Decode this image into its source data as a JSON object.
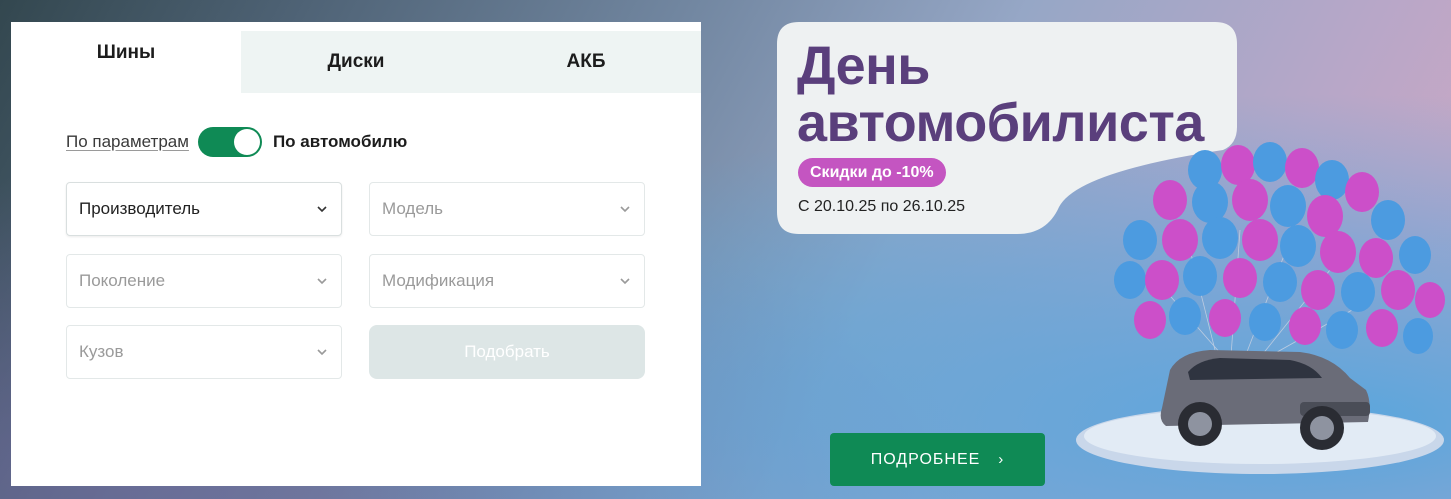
{
  "tabs": [
    {
      "label": "Шины",
      "active": true
    },
    {
      "label": "Диски",
      "active": false
    },
    {
      "label": "АКБ",
      "active": false
    }
  ],
  "mode_toggle": {
    "left_label": "По параметрам",
    "right_label": "По автомобилю",
    "state": "По автомобилю"
  },
  "selects": {
    "manufacturer": "Производитель",
    "model": "Модель",
    "generation": "Поколение",
    "modification": "Модификация",
    "body": "Кузов"
  },
  "pick_button": "Подобрать",
  "promo": {
    "title_line1": "День",
    "title_line2": "автомобилиста",
    "badge": "Скидки до -10%",
    "dates": "С 20.10.25 по 26.10.25",
    "more_button": "ПОДРОБНЕЕ",
    "illustration_icon": "car-with-balloons-icon"
  },
  "colors": {
    "accent_green": "#0f8a55",
    "title_purple": "#5a3f7c",
    "badge_pink": "#c455c1"
  }
}
